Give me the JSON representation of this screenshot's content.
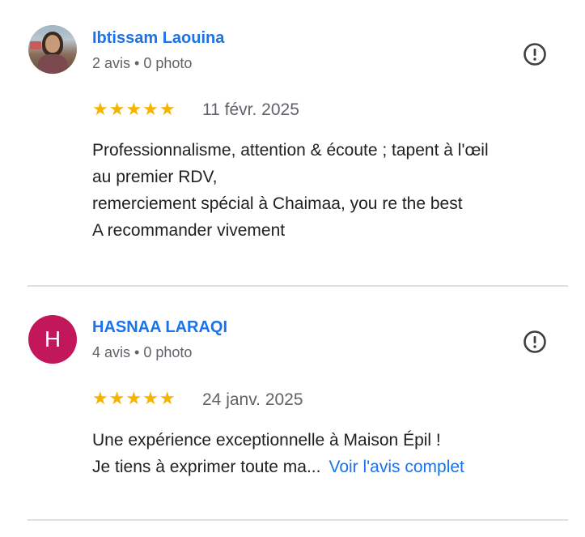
{
  "reviews": [
    {
      "author": "Ibtissam Laouina",
      "meta": "2 avis • 0 photo",
      "rating_stars": "★★★★★",
      "rating": 5,
      "date": "11 févr. 2025",
      "text_lines": [
        "Professionnalisme, attention & écoute ; tapent à l'œil",
        "au premier RDV,",
        "remerciement spécial à Chaimaa, you re the best",
        "A recommander vivement"
      ]
    },
    {
      "author": "HASNAA LARAQI",
      "avatar_letter": "H",
      "avatar_color": "#c2185b",
      "meta": "4 avis • 0 photo",
      "rating_stars": "★★★★★",
      "rating": 5,
      "date": "24 janv. 2025",
      "text_lines": [
        "Une expérience exceptionnelle à Maison Épil !",
        "Je tiens à exprimer toute ma..."
      ],
      "more_link": "Voir l'avis complet"
    }
  ],
  "icons": {
    "report": "report-icon"
  },
  "colors": {
    "name_link": "#1a73e8",
    "star": "#f4b400",
    "secondary_text": "#5f6368"
  }
}
